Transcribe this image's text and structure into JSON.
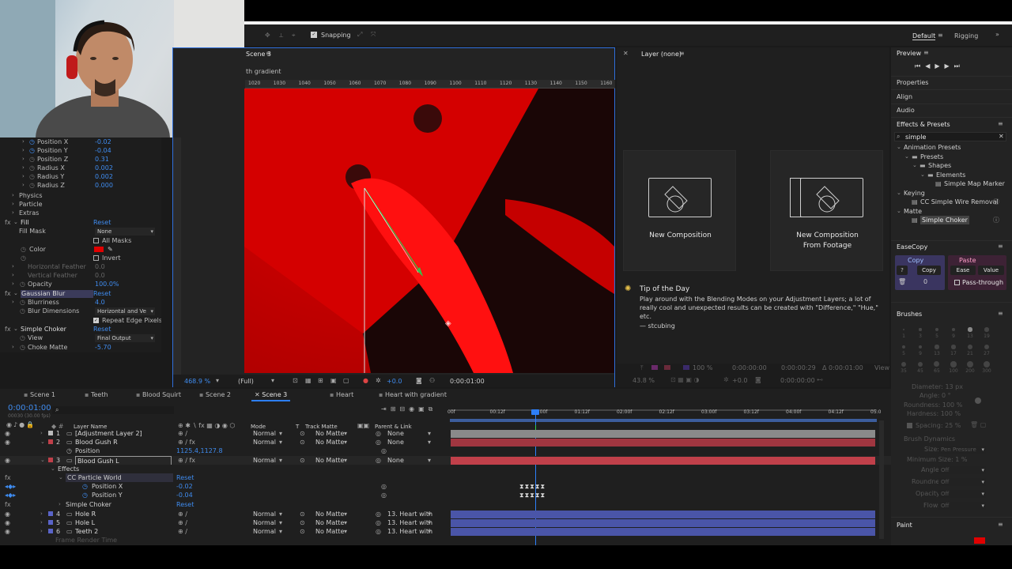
{
  "toolbar": {
    "snapping_label": "Snapping",
    "workspace_default": "Default",
    "workspace_rigging": "Rigging"
  },
  "comp_panel": {
    "tab_label": "Scene 3",
    "breadcrumb": "th gradient",
    "ruler_ticks": [
      "1020",
      "1030",
      "1040",
      "1050",
      "1060",
      "1070",
      "1080",
      "1090",
      "1100",
      "1110",
      "1120",
      "1130",
      "1140",
      "1150",
      "1160"
    ],
    "zoom": "468.9 %",
    "resolution": "(Full)",
    "exposure": "+0.0",
    "timecode": "0:00:01:00"
  },
  "layer_panel": {
    "title": "Layer (none)",
    "zoom": "43.8 %",
    "exposure": "+0.0",
    "timecode": "0:00:00:00",
    "percent": "100 %",
    "in_time": "0:00:00:00",
    "out_time": "0:00:00:29",
    "duration": "Δ 0:00:01:00",
    "view_label": "View"
  },
  "start_screen": {
    "new_comp": "New Composition",
    "new_comp_footage_1": "New Composition",
    "new_comp_footage_2": "From Footage",
    "tip_title": "Tip of the Day",
    "tip_text": "Play around with the Blending Modes on your Adjustment Layers; a lot of really cool and unexpected results can be created with \"Difference,\" \"Hue,\" etc.",
    "tip_author": "— stcubing"
  },
  "effects_controls": {
    "rows": [
      {
        "label": "Position X",
        "value": "-0.02"
      },
      {
        "label": "Position Y",
        "value": "-0.04"
      },
      {
        "label": "Position Z",
        "value": "0.31"
      },
      {
        "label": "Radius X",
        "value": "0.002"
      },
      {
        "label": "Radius Y",
        "value": "0.002"
      },
      {
        "label": "Radius Z",
        "value": "0.000"
      }
    ],
    "physics": "Physics",
    "particle": "Particle",
    "extras": "Extras",
    "fill": "Fill",
    "reset": "Reset",
    "fill_mask": "Fill Mask",
    "fill_mask_value": "None",
    "all_masks": "All Masks",
    "color": "Color",
    "invert": "Invert",
    "h_feather": "Horizontal Feather",
    "h_feather_value": "0.0",
    "v_feather": "Vertical Feather",
    "v_feather_value": "0.0",
    "opacity": "Opacity",
    "opacity_value": "100.0%",
    "gaussian_blur": "Gaussian Blur",
    "blurriness": "Blurriness",
    "blurriness_value": "4.0",
    "blur_dimensions": "Blur Dimensions",
    "blur_dimensions_value": "Horizontal and Ve",
    "repeat_edge": "Repeat Edge Pixels",
    "simple_choker": "Simple Choker",
    "view": "View",
    "view_value": "Final Output",
    "choke_matte": "Choke Matte",
    "choke_matte_value": "-5.70"
  },
  "right_panel": {
    "preview": "Preview",
    "properties": "Properties",
    "align": "Align",
    "audio": "Audio",
    "effects_presets": "Effects & Presets",
    "search": "simple",
    "tree": [
      {
        "label": "Animation Presets",
        "depth": 0
      },
      {
        "label": "Presets",
        "depth": 1
      },
      {
        "label": "Shapes",
        "depth": 2
      },
      {
        "label": "Elements",
        "depth": 3
      },
      {
        "label": "Simple Map Marker",
        "depth": 4
      },
      {
        "label": "Keying",
        "depth": 0
      },
      {
        "label": "CC Simple Wire Removal",
        "depth": 1
      },
      {
        "label": "Matte",
        "depth": 0
      },
      {
        "label": "Simple Choker",
        "depth": 1
      }
    ],
    "easecopy": "EaseCopy",
    "copy": "Copy",
    "copy_btn": "Copy",
    "paste": "Paste",
    "ease": "Ease",
    "value": "Value",
    "question": "?",
    "zero": "0",
    "pass_through": "Pass-through",
    "brushes": "Brushes",
    "diameter": "Diameter: 13 px",
    "angle": "Angle: 0 °",
    "roundness": "Roundness: 100 %",
    "hardness": "Hardness: 100 %",
    "spacing": "Spacing: 25 %",
    "brush_dynamics": "Brush Dynamics",
    "size": "Size:",
    "size_val": "Pen Pressure",
    "min_size": "Minimum Size: 1 %",
    "angle2": "Angle:",
    "roundness2": "Roundness:",
    "opacity2": "Opacity:",
    "flow2": "Flow:",
    "off": "Off",
    "paint": "Paint",
    "brush_sizes": [
      "1",
      "3",
      "5",
      "9",
      "13",
      "19",
      "5",
      "9",
      "13",
      "17",
      "21",
      "27",
      "35",
      "45",
      "65",
      "100",
      "200",
      "300"
    ]
  },
  "timeline": {
    "tabs": [
      "Scene 1",
      "Teeth",
      "Blood Squirt",
      "Scene 2",
      "Scene 3",
      "Heart",
      "Heart with gradient"
    ],
    "current_time": "0:00:01:00",
    "fps": "00030 (30.00 fps)",
    "col_layer_name": "Layer Name",
    "col_mode": "Mode",
    "col_t": "T",
    "col_track_matte": "Track Matte",
    "col_parent": "Parent & Link",
    "ruler": [
      "00f",
      "00:12f",
      "01:00f",
      "01:12f",
      "02:00f",
      "02:12f",
      "03:00f",
      "03:12f",
      "04:00f",
      "04:12f",
      "05:0"
    ],
    "layers": [
      {
        "num": "1",
        "name": "[Adjustment Layer 2]",
        "mode": "Normal",
        "matte": "No Matte",
        "parent": "None"
      },
      {
        "num": "2",
        "name": "Blood Gush R",
        "mode": "Normal",
        "matte": "No Matte",
        "parent": "None"
      },
      {
        "num": "3",
        "name": "Blood Gush L",
        "mode": "Normal",
        "matte": "No Matte",
        "parent": "None"
      },
      {
        "num": "4",
        "name": "Hole R",
        "mode": "Normal",
        "matte": "No Matte",
        "parent": "13. Heart with"
      },
      {
        "num": "5",
        "name": "Hole L",
        "mode": "Normal",
        "matte": "No Matte",
        "parent": "13. Heart with"
      },
      {
        "num": "6",
        "name": "Teeth 2",
        "mode": "Normal",
        "matte": "No Matte",
        "parent": "13. Heart with"
      }
    ],
    "position": "Position",
    "position_value": "1125.4,1127.8",
    "effects": "Effects",
    "cc_particle": "CC Particle World",
    "reset": "Reset",
    "pos_x": "Position X",
    "pos_x_val": "-0.02",
    "pos_y": "Position Y",
    "pos_y_val": "-0.04",
    "simple_choker": "Simple Choker",
    "frame_render": "Frame Render Time"
  },
  "colors": {
    "accent": "#2d7ff9",
    "value_blue": "#3f8cf0",
    "viewer_red": "#e00000",
    "layer_red": "#c0404a",
    "layer_blue": "#4a55a8"
  }
}
